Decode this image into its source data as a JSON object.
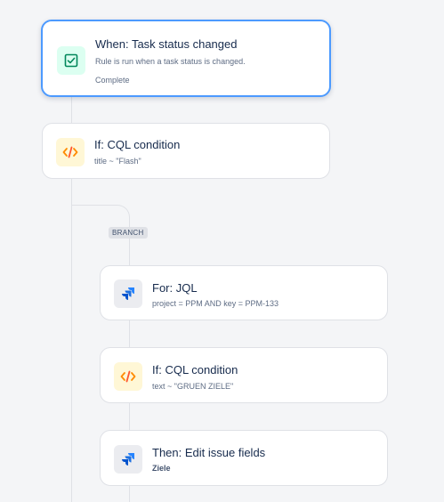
{
  "trigger": {
    "title": "When: Task status changed",
    "description": "Rule is run when a task status is changed.",
    "status": "Complete",
    "icon": "task-checkbox-icon"
  },
  "condition1": {
    "title": "If: CQL condition",
    "detail": "title ~ \"Flash\"",
    "icon": "code-icon"
  },
  "branch": {
    "label": "BRANCH"
  },
  "for_jql": {
    "title": "For: JQL",
    "detail": "project = PPM AND key = PPM-133",
    "icon": "jira-icon"
  },
  "condition2": {
    "title": "If: CQL condition",
    "detail": "text ~ \"GRUEN ZIELE\"",
    "icon": "code-icon"
  },
  "action": {
    "title": "Then: Edit issue fields",
    "detail": "Ziele",
    "icon": "jira-icon"
  },
  "colors": {
    "selected_border": "#4c9aff",
    "connector": "#dfe1e6",
    "green_bg": "#dcfff1",
    "yellow_bg": "#fff7d6",
    "code_orange": "#ff8b00",
    "jira_blue": "#2684ff"
  }
}
